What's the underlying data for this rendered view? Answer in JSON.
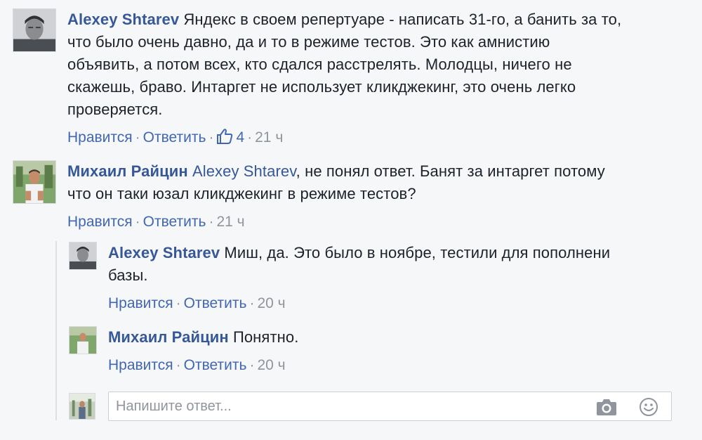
{
  "comments": [
    {
      "author": "Alexey Shtarev",
      "lines": [
        "Яндекс в своем репертуаре - написать 31-го, а банить за то,",
        "что было очень давно, да и то в режиме тестов. Это как амнистию",
        "объявить, а потом всех, кто сдался расстрелять. Молодцы, ничего не",
        "скажешь, браво. Интаргет не использует кликджекинг, это очень легко",
        "проверяется."
      ],
      "like_label": "Нравится",
      "reply_label": "Ответить",
      "likes": "4",
      "time": "21 ч"
    },
    {
      "author": "Михаил Райцин",
      "mention": "Alexey Shtarev",
      "lines": [
        ", не понял ответ. Банят за интаргет потому",
        "что он таки юзал кликджекинг в режиме тестов?"
      ],
      "like_label": "Нравится",
      "reply_label": "Ответить",
      "time": "21 ч"
    },
    {
      "author": "Alexey Shtarev",
      "lines": [
        "Миш, да. Это было в ноябре, тестили для пополнени",
        "базы."
      ],
      "like_label": "Нравится",
      "reply_label": "Ответить",
      "time": "20 ч"
    },
    {
      "author": "Михаил Райцин",
      "lines": [
        "Понятно."
      ],
      "like_label": "Нравится",
      "reply_label": "Ответить",
      "time": "20 ч"
    }
  ],
  "reply_box": {
    "placeholder": "Напишите ответ..."
  },
  "icons": {
    "like": "thumbs-up-icon",
    "camera": "camera-icon",
    "emoji": "smiley-icon"
  },
  "colors": {
    "link": "#4267b2",
    "author": "#365899",
    "meta": "#90949c",
    "background": "#f6f7f9"
  }
}
